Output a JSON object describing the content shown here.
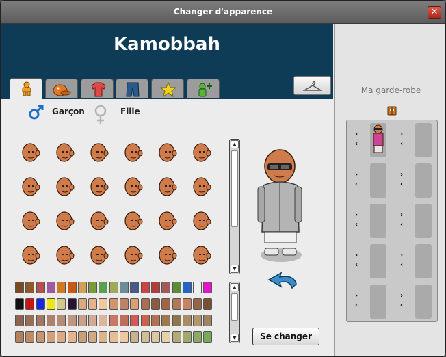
{
  "window": {
    "title": "Changer d'apparence",
    "close_label": "✕"
  },
  "header": {
    "avatar_name": "Kamobbah"
  },
  "tabs": [
    {
      "name": "body",
      "icon": "body-icon",
      "active": true
    },
    {
      "name": "hats",
      "icon": "hat-icon",
      "active": false
    },
    {
      "name": "shirts",
      "icon": "shirt-icon",
      "active": false
    },
    {
      "name": "pants",
      "icon": "pants-icon",
      "active": false
    },
    {
      "name": "effects",
      "icon": "star-icon",
      "active": false
    },
    {
      "name": "extras",
      "icon": "figure-plus-icon",
      "active": false
    }
  ],
  "gender": {
    "male_label": "Garçon",
    "female_label": "Fille"
  },
  "colors": {
    "skin": "#cf7c4c",
    "header_bg": "#0e3c57",
    "palette_row1": [
      "#7a4a22",
      "#8c5a2e",
      "#b45050",
      "#9c5aa0",
      "#d27a22",
      "#c85a14",
      "#d2a05a",
      "#7a9a3c",
      "#5aa050",
      "#a0aa5a",
      "#6e8c96",
      "#465a8c",
      "#c84646",
      "#b43c3c",
      "#a05a5a",
      "#5a8c3c",
      "#2864c8",
      "#f0f0f0",
      "#e614c8"
    ],
    "palette_row2": [
      "#111111",
      "#c81414",
      "#1428e6",
      "#f0e614",
      "#d2c88c",
      "#281432",
      "#dcaa82",
      "#e6b48c",
      "#f0c8a0",
      "#d2966e",
      "#be8264",
      "#dca078",
      "#aa6e50",
      "#8c5a3c",
      "#a06446",
      "#b4785a",
      "#c88264",
      "#966446",
      "#7a5032"
    ],
    "palette_row3": [
      "#8c6450",
      "#966e5a",
      "#a07864",
      "#aa826e",
      "#b48c78",
      "#be9682",
      "#c8a08c",
      "#d2aa96",
      "#dcb4a0",
      "#c87864",
      "#be6e5a",
      "#d25a5a",
      "#c8644b",
      "#b46e50",
      "#a07850",
      "#8c7850",
      "#aa8c64",
      "#b4966e",
      "#a08264"
    ],
    "palette_row4": [
      "#b4825a",
      "#be8c64",
      "#c8966e",
      "#d2a078",
      "#dcaa82",
      "#e6b48c",
      "#c8a078",
      "#d2aa82",
      "#dcb48c",
      "#e6be96",
      "#f0c8a0",
      "#c8b48c",
      "#d2be96",
      "#dcc8a0",
      "#e6d2aa",
      "#b4aa78",
      "#a0aa6e",
      "#8caa64",
      "#78aa5a"
    ]
  },
  "preview": {
    "change_button": "Se changer"
  },
  "wardrobe": {
    "title": "Ma garde-robe",
    "icon": "wardrobe-icon",
    "slots": [
      {
        "filled": true
      },
      {
        "filled": false
      },
      {
        "filled": false
      },
      {
        "filled": false
      },
      {
        "filled": false
      },
      {
        "filled": false
      },
      {
        "filled": false
      },
      {
        "filled": false
      },
      {
        "filled": false
      },
      {
        "filled": false
      }
    ],
    "arrow_right": "›",
    "arrow_left": "‹"
  }
}
